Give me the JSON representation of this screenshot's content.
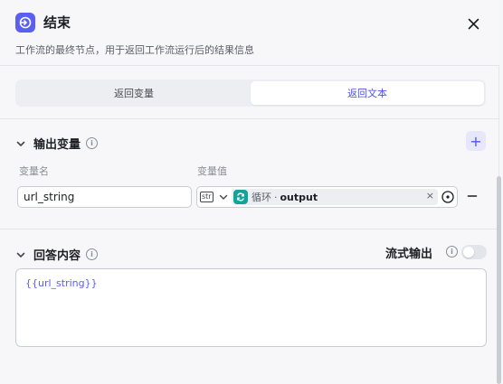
{
  "header": {
    "title": "结束",
    "description": "工作流的最终节点，用于返回工作流运行后的结果信息",
    "icon": "exit-icon",
    "accent_color": "#5a5ff0"
  },
  "tabs": [
    {
      "label": "返回变量",
      "active": false
    },
    {
      "label": "返回文本",
      "active": true
    }
  ],
  "output_section": {
    "title": "输出变量",
    "columns": {
      "name": "变量名",
      "value": "变量值"
    },
    "rows": [
      {
        "name": "url_string",
        "type_tag": "str",
        "ref_source": "循环",
        "ref_separator": "·",
        "ref_output": "output",
        "clear": "×"
      }
    ]
  },
  "answer_section": {
    "title": "回答内容",
    "stream_label": "流式输出",
    "stream_enabled": false,
    "content": "{{url_string}}"
  }
}
